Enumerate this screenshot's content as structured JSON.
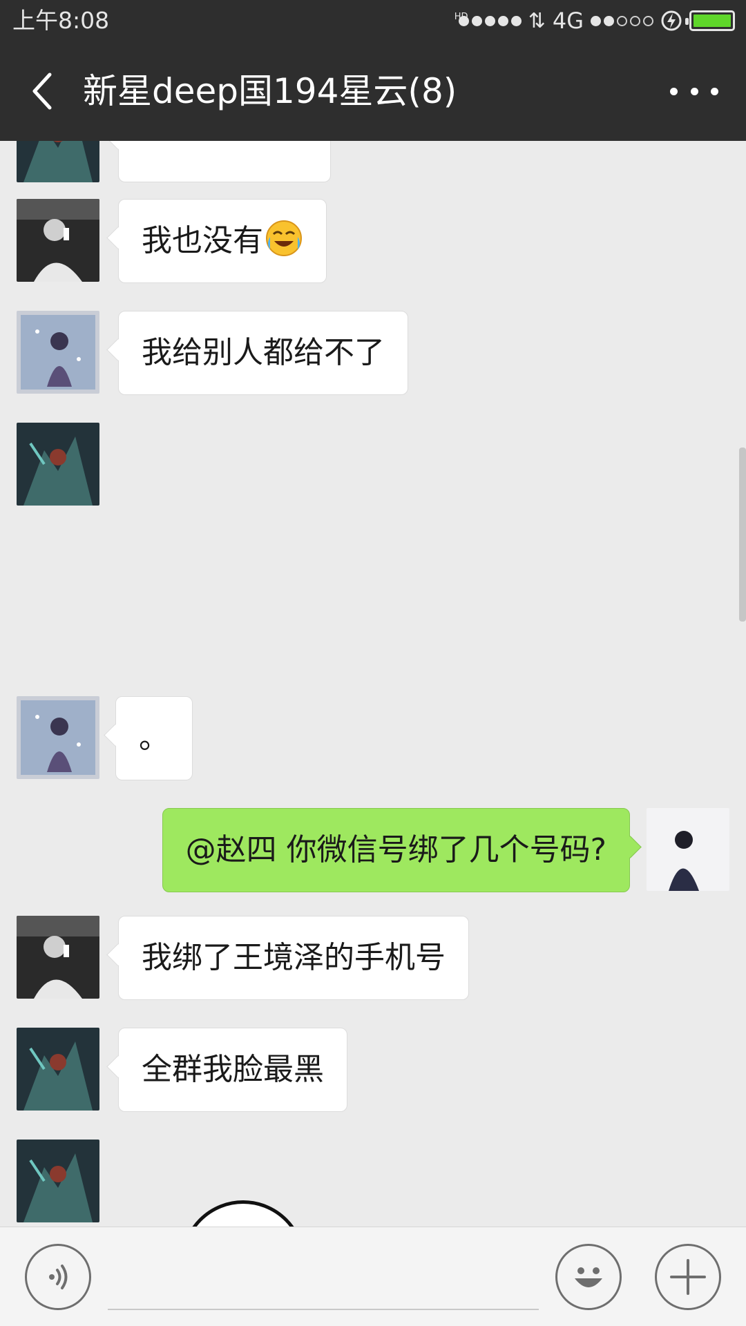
{
  "status_bar": {
    "time": "上午8:08",
    "network": "4G",
    "hd_label": "HD",
    "icons": [
      "signal-dots-icon",
      "data-arrows-icon",
      "wifi-dots-icon",
      "charging-icon",
      "battery-icon"
    ],
    "battery_level": 1.0,
    "battery_color": "#5fd62a"
  },
  "header": {
    "title": "新星deep国194星云(8)",
    "back_icon": "chevron-left-icon",
    "more_icon": "more-dots-icon",
    "background": "#2e2e2e"
  },
  "messages": [
    {
      "side": "left",
      "avatar": "avatar-warrior",
      "text": "我也没有",
      "emoji": "crying-laughing-emoji"
    },
    {
      "side": "left",
      "avatar": "avatar-snow-girl",
      "text": "我给别人都给不了"
    },
    {
      "side": "left",
      "avatar": "avatar-warrior",
      "text": ""
    },
    {
      "side": "left",
      "avatar": "avatar-snow-girl",
      "text": "。"
    },
    {
      "side": "right",
      "avatar": "avatar-self",
      "text": "@赵四  你微信号绑了几个号码?"
    },
    {
      "side": "left",
      "avatar": "avatar-boy-drinking",
      "text": "我绑了王境泽的手机号"
    },
    {
      "side": "left",
      "avatar": "avatar-warrior",
      "text": "全群我脸最黑"
    },
    {
      "side": "left",
      "avatar": "avatar-warrior",
      "text": ""
    }
  ],
  "colors": {
    "chat_background": "#ebebeb",
    "own_bubble": "#9ee85f",
    "other_bubble": "#ffffff"
  },
  "input_bar": {
    "value": "",
    "voice_icon": "voice-icon",
    "emoji_icon": "emoji-face-icon",
    "plus_icon": "plus-icon"
  }
}
